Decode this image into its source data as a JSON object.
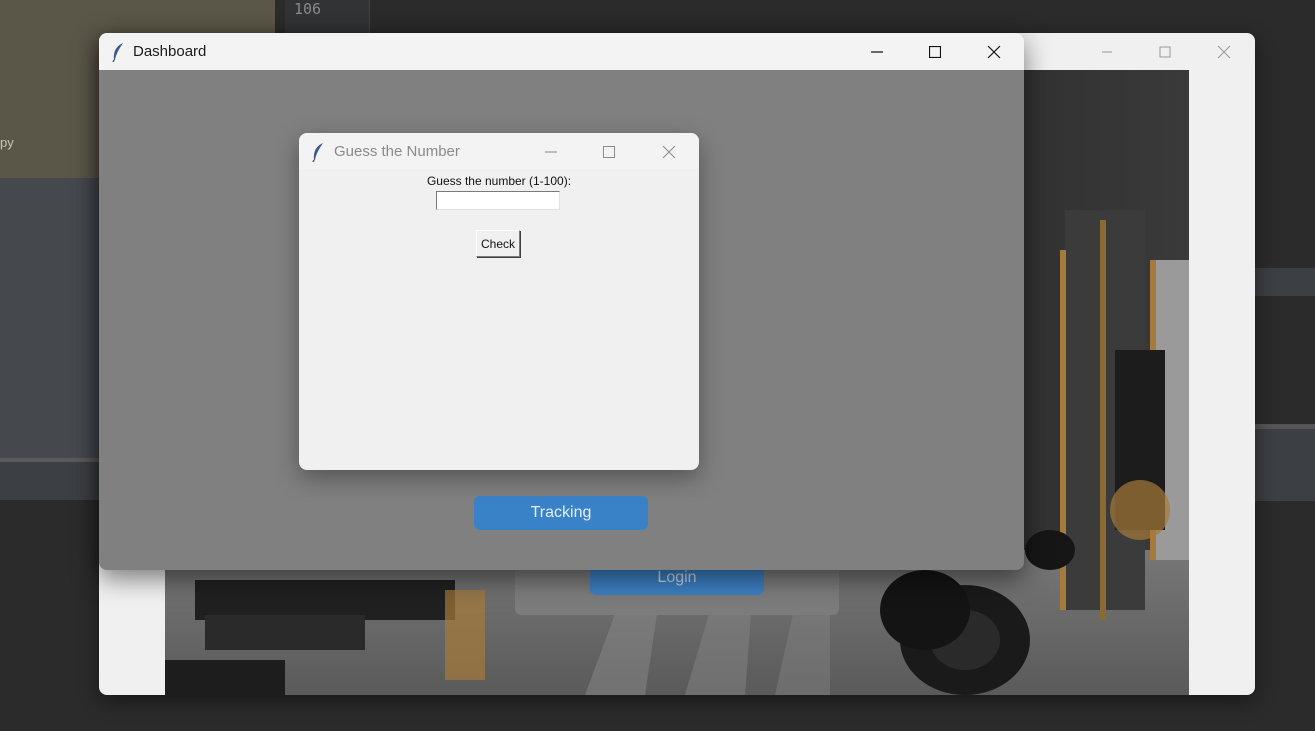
{
  "background": {
    "ide_line_number": "106",
    "ide_fragment_text": "py"
  },
  "login_window": {
    "login_button_label": "Login"
  },
  "dashboard_window": {
    "title": "Dashboard",
    "tracking_button_label": "Tracking"
  },
  "guess_dialog": {
    "title": "Guess the Number",
    "prompt_label": "Guess the number (1-100):",
    "input_value": "",
    "check_button_label": "Check"
  },
  "colors": {
    "accent_button": "#3a82c8",
    "dashboard_bg": "#808080",
    "dialog_bg": "#f0f0f0"
  },
  "icons": [
    "tk-feather-icon",
    "minimize-icon",
    "maximize-icon",
    "close-icon"
  ]
}
